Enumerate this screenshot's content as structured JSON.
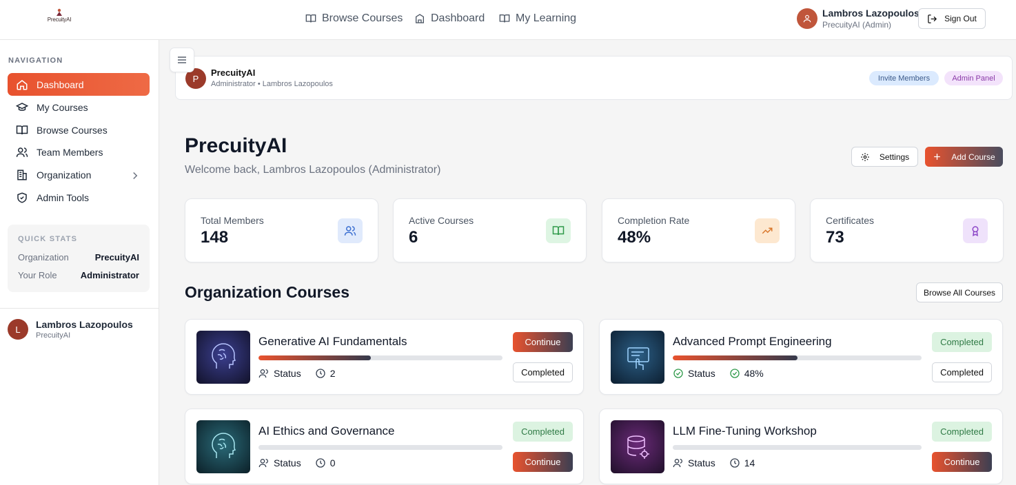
{
  "brand": {
    "logo_text": "PrecuityAI"
  },
  "topnav": {
    "links": [
      {
        "label": "Browse Courses",
        "icon": "book-icon"
      },
      {
        "label": "Dashboard",
        "icon": "building-icon"
      },
      {
        "label": "My Learning",
        "icon": "book-icon"
      }
    ],
    "user": {
      "name": "Lambros Lazopoulos",
      "subtitle": "PrecuityAI (Admin)"
    },
    "signout_label": "Sign Out"
  },
  "sidebar": {
    "heading": "NAVIGATION",
    "items": [
      {
        "label": "Dashboard",
        "icon": "home-icon",
        "active": true
      },
      {
        "label": "My Courses",
        "icon": "graduation-cap-icon"
      },
      {
        "label": "Browse Courses",
        "icon": "book-icon"
      },
      {
        "label": "Team Members",
        "icon": "users-icon"
      },
      {
        "label": "Organization",
        "icon": "building-icon",
        "has_submenu": true
      },
      {
        "label": "Admin Tools",
        "icon": "shield-icon"
      }
    ],
    "quick_stats": {
      "heading": "QUICK STATS",
      "rows": [
        {
          "key": "Organization",
          "value": "PrecuityAI"
        },
        {
          "key": "Your Role",
          "value": "Administrator"
        }
      ]
    },
    "user": {
      "initial": "L",
      "name": "Lambros Lazopoulos",
      "org": "PrecuityAI"
    }
  },
  "org_header": {
    "initial": "P",
    "name": "PrecuityAI",
    "subtitle": "Administrator • Lambros Lazopoulos",
    "invite_label": "Invite Members",
    "admin_label": "Admin Panel"
  },
  "page": {
    "title": "PrecuityAI",
    "welcome": "Welcome back, Lambros Lazopoulos (Administrator)",
    "settings_label": "Settings",
    "add_course_label": "Add Course"
  },
  "stats": [
    {
      "label": "Total Members",
      "value": "148",
      "icon": "users-icon",
      "color": "#e0eafc",
      "icon_color": "#3b6fd1"
    },
    {
      "label": "Active Courses",
      "value": "6",
      "icon": "book-open-icon",
      "color": "#def5e3",
      "icon_color": "#2f9a4a"
    },
    {
      "label": "Completion Rate",
      "value": "48%",
      "icon": "trending-up-icon",
      "color": "#fde8d0",
      "icon_color": "#d9772b"
    },
    {
      "label": "Certificates",
      "value": "73",
      "icon": "award-icon",
      "color": "#efe2fb",
      "icon_color": "#8b45c7"
    }
  ],
  "courses_section": {
    "title": "Organization Courses",
    "browse_all_label": "Browse All Courses",
    "courses": [
      {
        "title": "Generative AI Fundamentals",
        "progress": 0.46,
        "meta_icon": "users-icon",
        "meta_label": "Status",
        "count_icon": "clock-icon",
        "count": "2",
        "primary": {
          "label": "Continue",
          "style": "continue"
        },
        "secondary": {
          "label": "Completed",
          "style": "outline"
        },
        "image_icon": "brain-head-icon"
      },
      {
        "title": "Advanced Prompt Engineering",
        "progress": 0.5,
        "meta_icon": "check-circle-icon",
        "meta_label": "Status",
        "count_icon": "check-circle-icon",
        "count": "48%",
        "primary": {
          "label": "Completed",
          "style": "done"
        },
        "secondary": {
          "label": "Completed",
          "style": "outline"
        },
        "image_icon": "screen-touch-icon"
      },
      {
        "title": "AI Ethics and Governance",
        "progress": 0.0,
        "meta_icon": "users-icon",
        "meta_label": "Status",
        "count_icon": "clock-icon",
        "count": "0",
        "primary": {
          "label": "Completed",
          "style": "done"
        },
        "secondary": {
          "label": "Continue",
          "style": "continue"
        },
        "image_icon": "brain-head-icon"
      },
      {
        "title": "LLM Fine-Tuning Workshop",
        "progress": 0.0,
        "meta_icon": "users-icon",
        "meta_label": "Status",
        "count_icon": "clock-icon",
        "count": "14",
        "primary": {
          "label": "Completed",
          "style": "done"
        },
        "secondary": {
          "label": "Continue",
          "style": "continue"
        },
        "image_icon": "database-icon"
      }
    ]
  }
}
